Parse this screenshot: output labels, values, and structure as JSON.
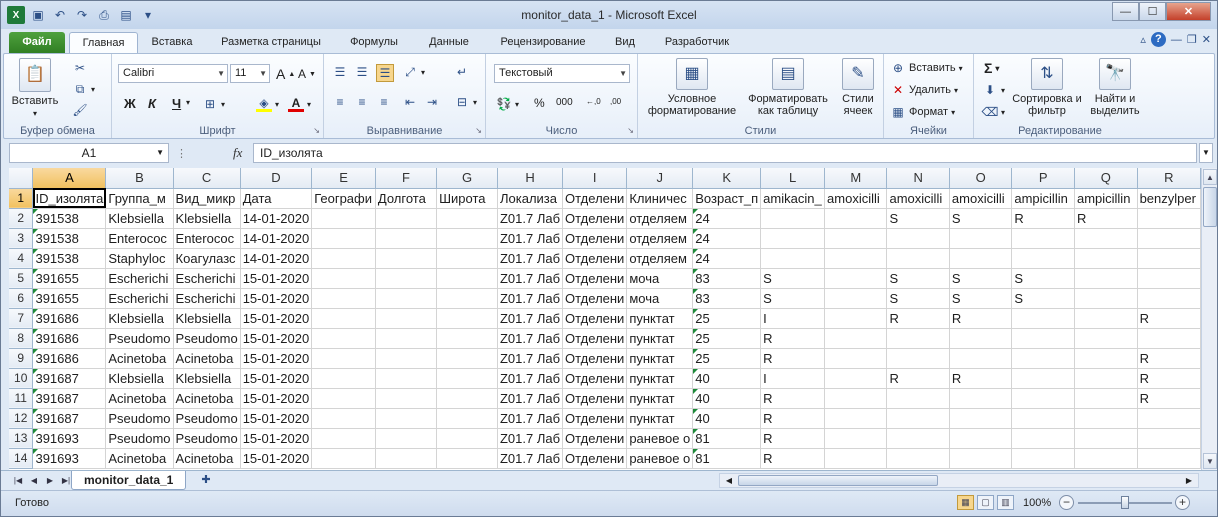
{
  "window": {
    "title": "monitor_data_1  -  Microsoft Excel",
    "min": "—",
    "max": "☐",
    "close": "✕"
  },
  "qat": {
    "icons": [
      "excel-logo-icon",
      "save-icon",
      "undo-icon",
      "redo-icon",
      "print-preview-icon",
      "new-icon",
      "customize-qat-icon"
    ]
  },
  "tabs": [
    "Файл",
    "Главная",
    "Вставка",
    "Разметка страницы",
    "Формулы",
    "Данные",
    "Рецензирование",
    "Вид",
    "Разработчик"
  ],
  "ribbon": {
    "clipboard": {
      "label": "Буфер обмена",
      "paste": "Вставить"
    },
    "font": {
      "label": "Шрифт",
      "name": "Calibri",
      "size": "11",
      "bold": "Ж",
      "italic": "К",
      "underline": "Ч",
      "grow": "A",
      "shrink": "A"
    },
    "alignment": {
      "label": "Выравнивание"
    },
    "number": {
      "label": "Число",
      "format": "Текстовый",
      "percent": "%",
      "thousands": "000",
      "inc": "←,0",
      "dec": ",00"
    },
    "styles": {
      "label": "Стили",
      "cond": "Условное форматирование",
      "table": "Форматировать как таблицу",
      "cell": "Стили ячеек"
    },
    "cells": {
      "label": "Ячейки",
      "insert": "Вставить",
      "delete": "Удалить",
      "format": "Формат"
    },
    "editing": {
      "label": "Редактирование",
      "sum": "Σ",
      "sort": "Сортировка и фильтр",
      "find": "Найти и выделить"
    }
  },
  "formula": {
    "namebox": "A1",
    "fx": "fx",
    "value": "ID_изолята"
  },
  "grid": {
    "columns": [
      "A",
      "B",
      "C",
      "D",
      "E",
      "F",
      "G",
      "H",
      "I",
      "J",
      "K",
      "L",
      "M",
      "N",
      "O",
      "P",
      "Q",
      "R"
    ],
    "header_row": [
      "ID_изолята",
      "Группа_м",
      "Вид_микр",
      "Дата",
      "Географи",
      "Долгота",
      "Широта",
      "Локализа",
      "Отделени",
      "Клиничес",
      "Возраст_п",
      "amikacin_",
      "amoxicilli",
      "amoxicilli",
      "amoxicilli",
      "ampicillin",
      "ampicillin",
      "benzylper"
    ],
    "rows": [
      [
        "391538",
        "Klebsiella",
        "Klebsiella",
        "14-01-2020",
        "",
        "",
        "",
        "Z01.7 Лаб",
        "Отделени",
        "отделяем",
        "24",
        "",
        "",
        "S",
        "S",
        "R",
        "R",
        ""
      ],
      [
        "391538",
        "Enterococ",
        "Enterococ",
        "14-01-2020",
        "",
        "",
        "",
        "Z01.7 Лаб",
        "Отделени",
        "отделяем",
        "24",
        "",
        "",
        "",
        "",
        "",
        "",
        ""
      ],
      [
        "391538",
        "Staphyloc",
        "Коагулазс",
        "14-01-2020",
        "",
        "",
        "",
        "Z01.7 Лаб",
        "Отделени",
        "отделяем",
        "24",
        "",
        "",
        "",
        "",
        "",
        "",
        ""
      ],
      [
        "391655",
        "Escherichi",
        "Escherichi",
        "15-01-2020",
        "",
        "",
        "",
        "Z01.7 Лаб",
        "Отделени",
        "моча",
        "83",
        "S",
        "",
        "S",
        "S",
        "S",
        "",
        ""
      ],
      [
        "391655",
        "Escherichi",
        "Escherichi",
        "15-01-2020",
        "",
        "",
        "",
        "Z01.7 Лаб",
        "Отделени",
        "моча",
        "83",
        "S",
        "",
        "S",
        "S",
        "S",
        "",
        ""
      ],
      [
        "391686",
        "Klebsiella",
        "Klebsiella",
        "15-01-2020",
        "",
        "",
        "",
        "Z01.7 Лаб",
        "Отделени",
        "пунктат",
        "25",
        "I",
        "",
        "R",
        "R",
        "",
        "",
        "R"
      ],
      [
        "391686",
        "Pseudomo",
        "Pseudomo",
        "15-01-2020",
        "",
        "",
        "",
        "Z01.7 Лаб",
        "Отделени",
        "пунктат",
        "25",
        "R",
        "",
        "",
        "",
        "",
        "",
        ""
      ],
      [
        "391686",
        "Acinetoba",
        "Acinetoba",
        "15-01-2020",
        "",
        "",
        "",
        "Z01.7 Лаб",
        "Отделени",
        "пунктат",
        "25",
        "R",
        "",
        "",
        "",
        "",
        "",
        "R"
      ],
      [
        "391687",
        "Klebsiella",
        "Klebsiella",
        "15-01-2020",
        "",
        "",
        "",
        "Z01.7 Лаб",
        "Отделени",
        "пунктат",
        "40",
        "I",
        "",
        "R",
        "R",
        "",
        "",
        "R"
      ],
      [
        "391687",
        "Acinetoba",
        "Acinetoba",
        "15-01-2020",
        "",
        "",
        "",
        "Z01.7 Лаб",
        "Отделени",
        "пунктат",
        "40",
        "R",
        "",
        "",
        "",
        "",
        "",
        "R"
      ],
      [
        "391687",
        "Pseudomo",
        "Pseudomo",
        "15-01-2020",
        "",
        "",
        "",
        "Z01.7 Лаб",
        "Отделени",
        "пунктат",
        "40",
        "R",
        "",
        "",
        "",
        "",
        "",
        ""
      ],
      [
        "391693",
        "Pseudomo",
        "Pseudomo",
        "15-01-2020",
        "",
        "",
        "",
        "Z01.7 Лаб",
        "Отделени",
        "раневое о",
        "81",
        "R",
        "",
        "",
        "",
        "",
        "",
        ""
      ],
      [
        "391693",
        "Acinetoba",
        "Acinetoba",
        "15-01-2020",
        "",
        "",
        "",
        "Z01.7 Лаб",
        "Отделени",
        "раневое о",
        "81",
        "R",
        "",
        "",
        "",
        "",
        "",
        ""
      ]
    ]
  },
  "sheet": {
    "name": "monitor_data_1"
  },
  "status": {
    "text": "Готово",
    "zoom": "100%"
  }
}
